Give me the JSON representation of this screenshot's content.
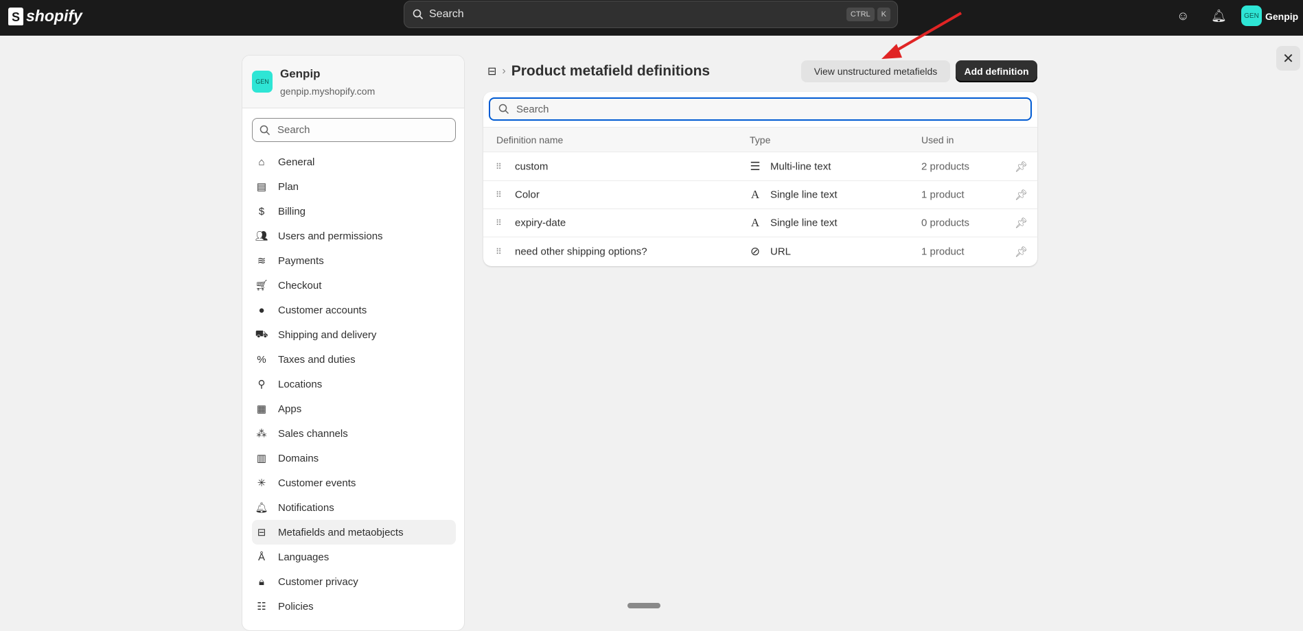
{
  "topbar": {
    "logo": "shopify",
    "search_placeholder": "Search",
    "keys": [
      "CTRL",
      "K"
    ],
    "user_initials": "GEN",
    "user_name": "Genpip"
  },
  "store": {
    "initials": "GEN",
    "name": "Genpip",
    "domain": "genpip.myshopify.com"
  },
  "sidebar": {
    "search_placeholder": "Search",
    "items": [
      {
        "label": "General",
        "icon": "store-icon"
      },
      {
        "label": "Plan",
        "icon": "plan-icon"
      },
      {
        "label": "Billing",
        "icon": "billing-icon"
      },
      {
        "label": "Users and permissions",
        "icon": "users-icon"
      },
      {
        "label": "Payments",
        "icon": "payments-icon"
      },
      {
        "label": "Checkout",
        "icon": "cart-icon"
      },
      {
        "label": "Customer accounts",
        "icon": "person-icon"
      },
      {
        "label": "Shipping and delivery",
        "icon": "truck-icon"
      },
      {
        "label": "Taxes and duties",
        "icon": "tax-icon"
      },
      {
        "label": "Locations",
        "icon": "location-icon"
      },
      {
        "label": "Apps",
        "icon": "apps-icon"
      },
      {
        "label": "Sales channels",
        "icon": "channels-icon"
      },
      {
        "label": "Domains",
        "icon": "domains-icon"
      },
      {
        "label": "Customer events",
        "icon": "cursor-click-icon"
      },
      {
        "label": "Notifications",
        "icon": "bell-icon"
      },
      {
        "label": "Metafields and metaobjects",
        "icon": "metafields-icon",
        "active": true
      },
      {
        "label": "Languages",
        "icon": "language-icon"
      },
      {
        "label": "Customer privacy",
        "icon": "lock-icon"
      },
      {
        "label": "Policies",
        "icon": "policies-icon"
      }
    ]
  },
  "main": {
    "title": "Product metafield definitions",
    "view_unstructured": "View unstructured metafields",
    "add_definition": "Add definition",
    "search_placeholder": "Search",
    "columns": [
      "Definition name",
      "Type",
      "Used in"
    ],
    "rows": [
      {
        "name": "custom",
        "type": "Multi-line text",
        "type_icon": "multiline-text-icon",
        "used": "2 products"
      },
      {
        "name": "Color",
        "type": "Single line text",
        "type_icon": "single-line-text-icon",
        "used": "1 product"
      },
      {
        "name": "expiry-date",
        "type": "Single line text",
        "type_icon": "single-line-text-icon",
        "used": "0 products"
      },
      {
        "name": "need other shipping options?",
        "type": "URL",
        "type_icon": "url-icon",
        "used": "1 product"
      }
    ]
  },
  "colors": {
    "topbar": "#1a1a1a",
    "avatar": "#2ee5d5",
    "focus": "#005bd3",
    "primary_button": "#303030",
    "annotation_arrow": "#e02424"
  }
}
